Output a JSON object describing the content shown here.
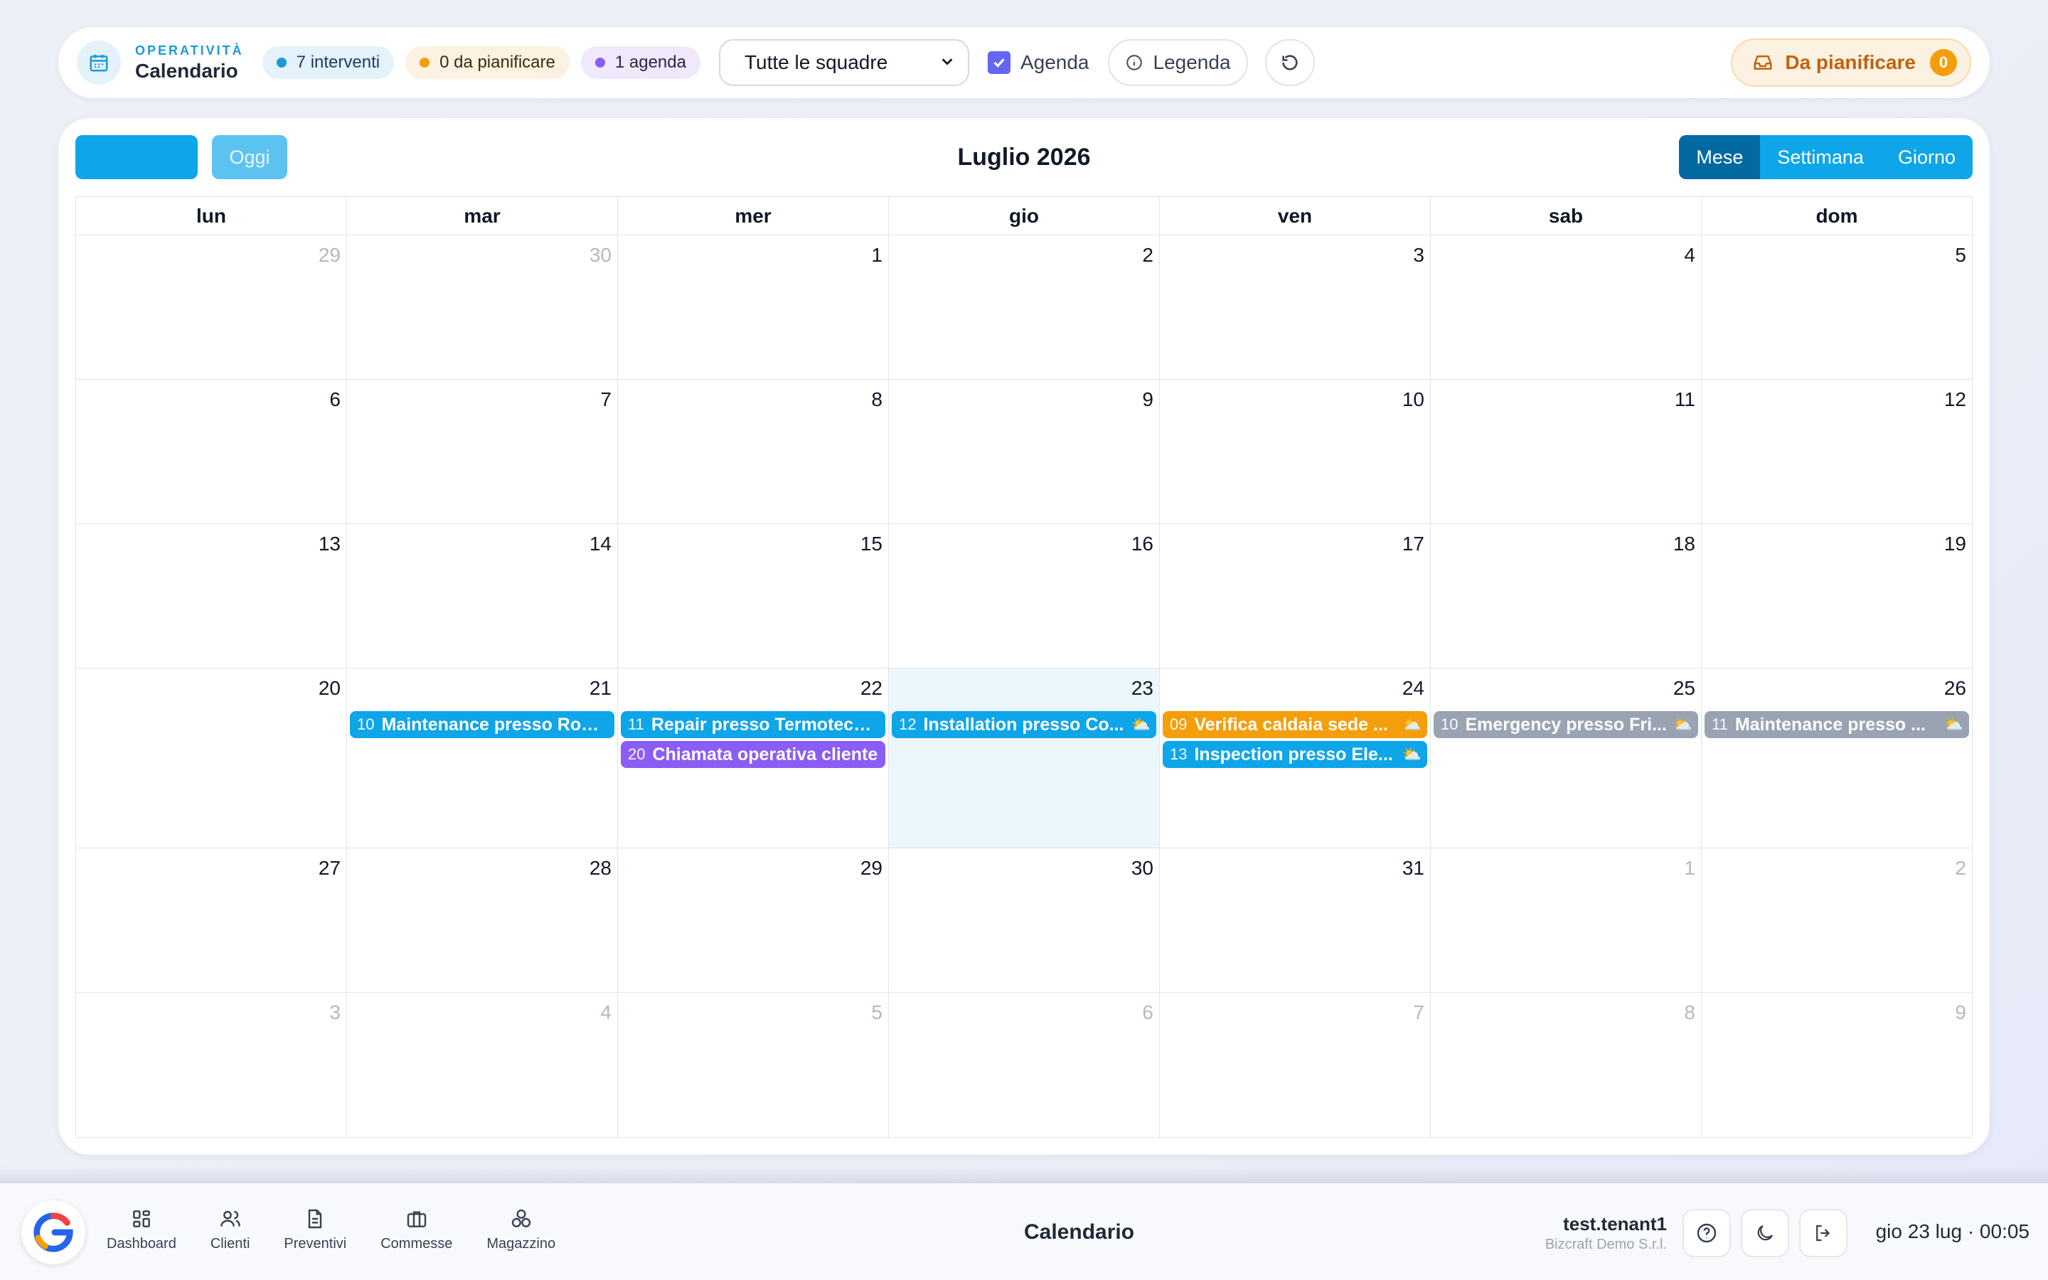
{
  "toolbar": {
    "kicker": "OPERATIVITÀ",
    "title": "Calendario",
    "pills": {
      "interventi": "7 interventi",
      "da_pianificare": "0 da pianificare",
      "agenda": "1 agenda"
    },
    "team_select": "Tutte le squadre",
    "agenda_checkbox_label": "Agenda",
    "agenda_checked": true,
    "legend_label": "Legenda",
    "da_pianificare_label": "Da pianificare",
    "da_pianificare_count": "0"
  },
  "calendar": {
    "today_label": "Oggi",
    "title": "Luglio 2026",
    "views": [
      "Mese",
      "Settimana",
      "Giorno"
    ],
    "active_view": "Mese",
    "weekdays": [
      "lun",
      "mar",
      "mer",
      "gio",
      "ven",
      "sab",
      "dom"
    ],
    "weeks": [
      {
        "days": [
          {
            "n": "29",
            "other": true
          },
          {
            "n": "30",
            "other": true
          },
          {
            "n": "1"
          },
          {
            "n": "2"
          },
          {
            "n": "3"
          },
          {
            "n": "4"
          },
          {
            "n": "5"
          }
        ]
      },
      {
        "days": [
          {
            "n": "6"
          },
          {
            "n": "7"
          },
          {
            "n": "8"
          },
          {
            "n": "9"
          },
          {
            "n": "10"
          },
          {
            "n": "11"
          },
          {
            "n": "12"
          }
        ]
      },
      {
        "days": [
          {
            "n": "13"
          },
          {
            "n": "14"
          },
          {
            "n": "15"
          },
          {
            "n": "16"
          },
          {
            "n": "17"
          },
          {
            "n": "18"
          },
          {
            "n": "19"
          }
        ]
      },
      {
        "tall": true,
        "days": [
          {
            "n": "20"
          },
          {
            "n": "21",
            "events": [
              {
                "time": "10",
                "label": "Maintenance presso Rossi Group",
                "color": "#0ea5e9"
              }
            ]
          },
          {
            "n": "22",
            "events": [
              {
                "time": "11",
                "label": "Repair presso Termotecnica",
                "color": "#0ea5e9"
              },
              {
                "time": "20",
                "label": "Chiamata operativa cliente",
                "color": "#8b5cf6"
              }
            ]
          },
          {
            "n": "23",
            "today": true,
            "events": [
              {
                "time": "12",
                "label": "Installation presso Co...",
                "color": "#0ea5e9",
                "weather": "⛅"
              }
            ]
          },
          {
            "n": "24",
            "events": [
              {
                "time": "09",
                "label": "Verifica caldaia sede ...",
                "color": "#f59e0b",
                "weather": "⛅"
              },
              {
                "time": "13",
                "label": "Inspection presso Ele...",
                "color": "#0ea5e9",
                "weather": "⛅"
              }
            ]
          },
          {
            "n": "25",
            "events": [
              {
                "time": "10",
                "label": "Emergency presso Fri...",
                "color": "#9aa3b2",
                "weather": "⛅"
              }
            ]
          },
          {
            "n": "26",
            "events": [
              {
                "time": "11",
                "label": "Maintenance presso ...",
                "color": "#9aa3b2",
                "weather": "⛅"
              }
            ]
          }
        ]
      },
      {
        "days": [
          {
            "n": "27"
          },
          {
            "n": "28"
          },
          {
            "n": "29"
          },
          {
            "n": "30"
          },
          {
            "n": "31"
          },
          {
            "n": "1",
            "other": true
          },
          {
            "n": "2",
            "other": true
          }
        ]
      },
      {
        "days": [
          {
            "n": "3",
            "other": true
          },
          {
            "n": "4",
            "other": true
          },
          {
            "n": "5",
            "other": true
          },
          {
            "n": "6",
            "other": true
          },
          {
            "n": "7",
            "other": true
          },
          {
            "n": "8",
            "other": true
          },
          {
            "n": "9",
            "other": true
          }
        ]
      }
    ]
  },
  "bottombar": {
    "nav": [
      "Dashboard",
      "Clienti",
      "Preventivi",
      "Commesse",
      "Magazzino"
    ],
    "title": "Calendario",
    "user": "test.tenant1",
    "org": "Bizcraft Demo S.r.l.",
    "clock": "gio 23 lug · 00:05"
  },
  "colors": {
    "accent": "#0ea5e9",
    "accent_dark": "#0369a1",
    "today_bg": "#ecf6fd",
    "warning": "#f59e0b",
    "agenda": "#8b5cf6",
    "muted_event": "#9aa3b2"
  },
  "icons": [
    "calendar-icon",
    "chevron-down-icon",
    "check-icon",
    "info-icon",
    "refresh-icon",
    "inbox-icon",
    "dashboard-icon",
    "users-icon",
    "document-icon",
    "briefcase-icon",
    "boxes-icon",
    "help-icon",
    "moon-icon",
    "logout-icon",
    "weather-icon"
  ]
}
